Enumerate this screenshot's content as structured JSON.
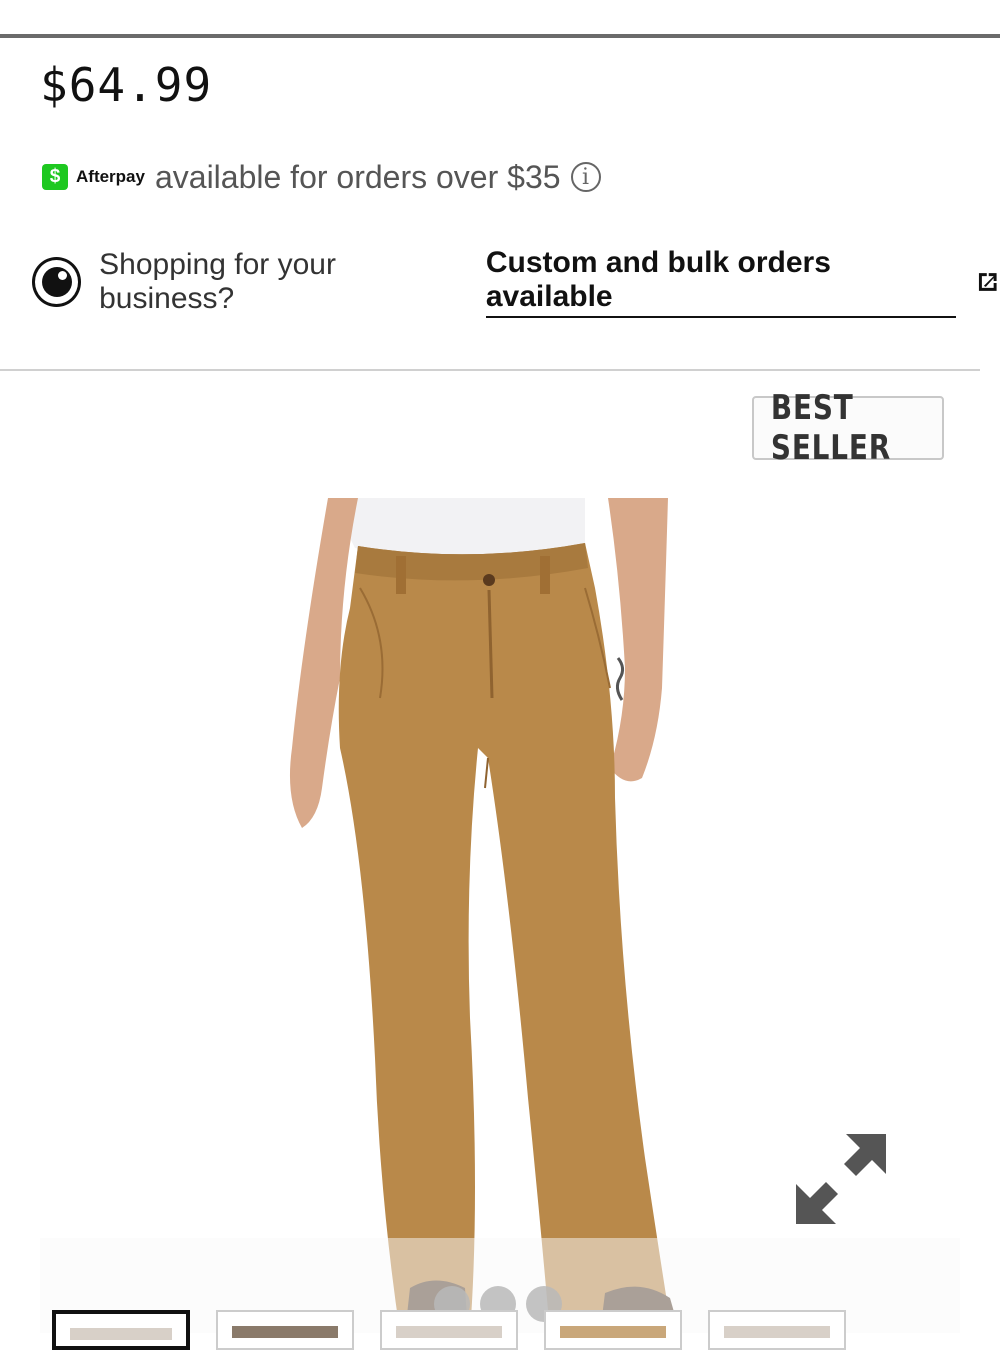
{
  "product": {
    "price": "$64.99"
  },
  "afterpay": {
    "badge_symbol": "$",
    "brand": "Afterpay",
    "text": "available for orders over $35",
    "info_symbol": "i",
    "brand_color": "#1ec820"
  },
  "business": {
    "prompt": "Shopping for your business?",
    "link_label": "Custom and bulk orders available"
  },
  "badge": {
    "label": "BEST SELLER"
  },
  "gallery": {
    "image_name": "brown-work-pants-photo",
    "pants_color": "#b9894a",
    "slide_count": 3,
    "thumbnail_count": 5,
    "active_thumbnail": 1
  }
}
